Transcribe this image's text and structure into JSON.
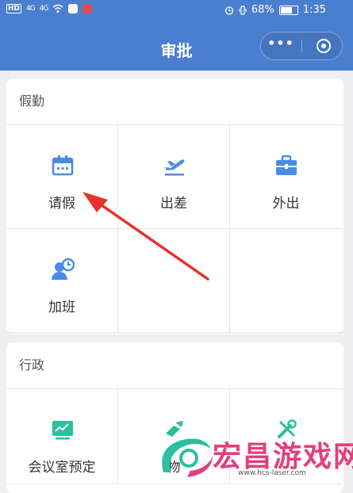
{
  "status_bar": {
    "left_badge": "HD",
    "signal_1": "4G",
    "signal_2": "4G",
    "battery_percent": "68%",
    "time": "1:35"
  },
  "header": {
    "title": "审批",
    "more_icon": "more-dots-icon",
    "close_icon": "close-circle-icon"
  },
  "sections": [
    {
      "title": "假勤",
      "items": [
        {
          "label": "请假",
          "icon": "calendar-icon"
        },
        {
          "label": "出差",
          "icon": "airplane-icon"
        },
        {
          "label": "外出",
          "icon": "briefcase-icon"
        },
        {
          "label": "加班",
          "icon": "person-clock-icon"
        }
      ]
    },
    {
      "title": "行政",
      "items": [
        {
          "label": "会议室预定",
          "icon": "presentation-board-icon"
        },
        {
          "label": "物",
          "icon": "item-icon"
        },
        {
          "label": "",
          "icon": "tools-icon"
        }
      ]
    }
  ],
  "watermark": {
    "text": "宏昌游戏网",
    "url": "www.hcs-laser.com"
  },
  "colors": {
    "header_bg": "#4a7fd0",
    "icon_blue": "#4a8be8",
    "icon_teal": "#2bbf9e",
    "arrow_red": "#e8312a",
    "watermark": "#e23f7c"
  }
}
